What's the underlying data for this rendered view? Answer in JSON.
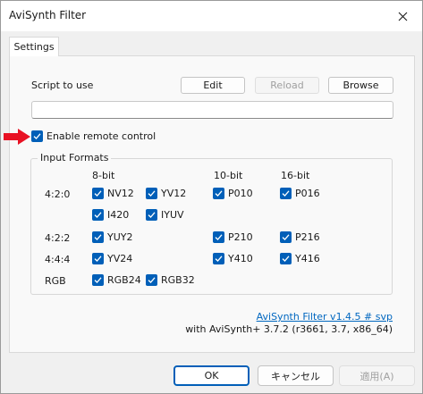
{
  "window": {
    "title": "AviSynth Filter"
  },
  "tabs": [
    {
      "label": "Settings"
    }
  ],
  "script": {
    "label": "Script to use",
    "edit_label": "Edit",
    "reload_label": "Reload",
    "browse_label": "Browse",
    "path_value": ""
  },
  "remote": {
    "label": "Enable remote control",
    "checked": true
  },
  "formats": {
    "group_title": "Input Formats",
    "col_8bit": "8-bit",
    "col_10bit": "10-bit",
    "col_16bit": "16-bit",
    "row_420": "4:2:0",
    "row_422": "4:2:2",
    "row_444": "4:4:4",
    "row_rgb": "RGB",
    "nv12": "NV12",
    "yv12": "YV12",
    "p010": "P010",
    "p016": "P016",
    "i420": "I420",
    "iyuv": "IYUV",
    "yuy2": "YUY2",
    "p210": "P210",
    "p216": "P216",
    "yv24": "YV24",
    "y410": "Y410",
    "y416": "Y416",
    "rgb24": "RGB24",
    "rgb32": "RGB32"
  },
  "about": {
    "link": "AviSynth Filter v1.4.5 # svp",
    "version": "with AviSynth+ 3.7.2 (r3661, 3.7, x86_64)"
  },
  "buttons": {
    "ok": "OK",
    "cancel": "キャンセル",
    "apply": "適用(A)"
  },
  "colors": {
    "accent": "#005fb8",
    "link": "#0067c0",
    "arrow": "#e81123"
  }
}
